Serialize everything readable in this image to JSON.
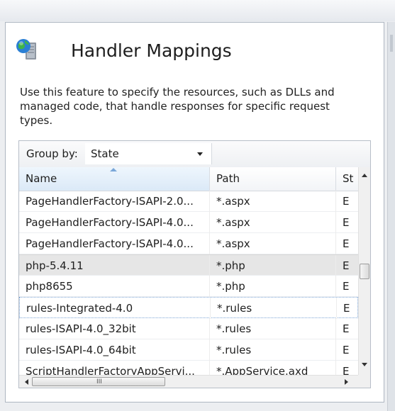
{
  "feature": {
    "title": "Handler Mappings",
    "icon": "server-globe-icon",
    "description": "Use this feature to specify the resources, such as DLLs and managed code, that handle responses for specific request types."
  },
  "grouping": {
    "label": "Group by:",
    "value": "State"
  },
  "table": {
    "columns": [
      "Name",
      "Path",
      "St"
    ],
    "sort": {
      "column": "Name",
      "direction": "ascending"
    },
    "rows": [
      {
        "name": "PageHandlerFactory-ISAPI-2.0...",
        "path": "*.aspx",
        "state": "E"
      },
      {
        "name": "PageHandlerFactory-ISAPI-4.0...",
        "path": "*.aspx",
        "state": "E"
      },
      {
        "name": "PageHandlerFactory-ISAPI-4.0...",
        "path": "*.aspx",
        "state": "E"
      },
      {
        "name": "php-5.4.11",
        "path": "*.php",
        "state": "E"
      },
      {
        "name": "php8655",
        "path": "*.php",
        "state": "E"
      },
      {
        "name": "rules-Integrated-4.0",
        "path": "*.rules",
        "state": "E"
      },
      {
        "name": "rules-ISAPI-4.0_32bit",
        "path": "*.rules",
        "state": "E"
      },
      {
        "name": "rules-ISAPI-4.0_64bit",
        "path": "*.rules",
        "state": "E"
      },
      {
        "name": "ScriptHandlerFactoryAppServi...",
        "path": "*.AppService.axd",
        "state": "E"
      }
    ]
  },
  "scrollbars": {
    "horizontal_grip": "III"
  },
  "colors": {
    "selected_row": "#e6e6e6",
    "focus_outline": "#7ea6d6",
    "panel_border": "#aeb6c1"
  }
}
